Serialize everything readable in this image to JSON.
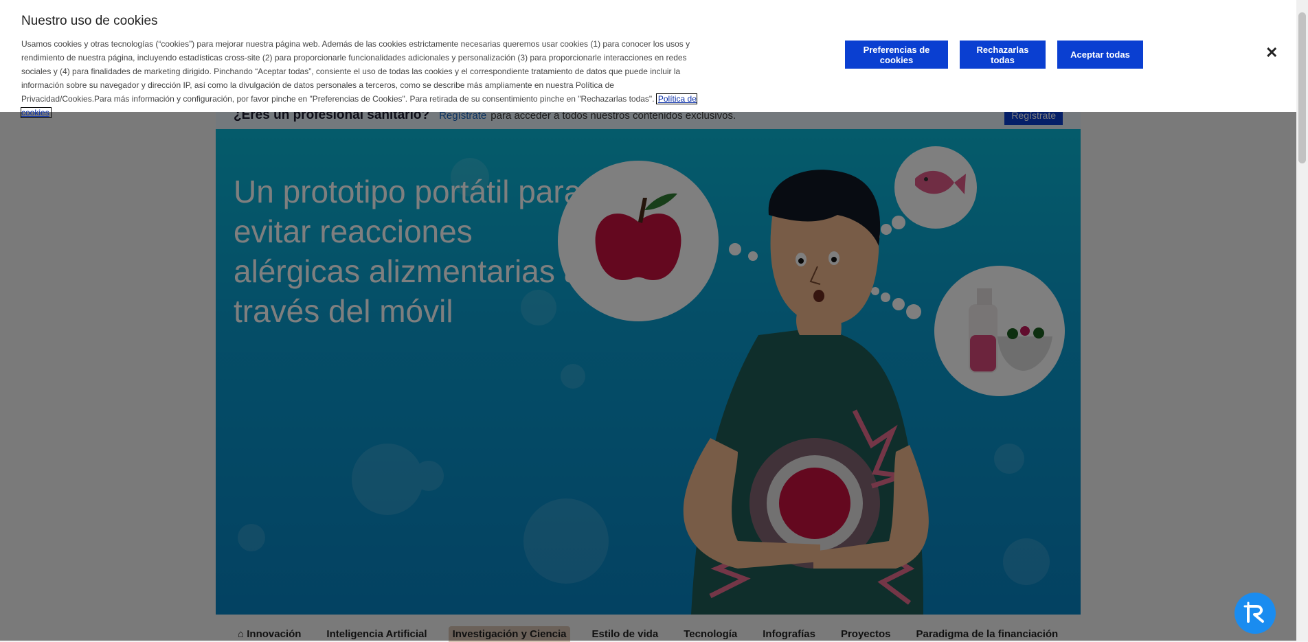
{
  "cookie_banner": {
    "title": "Nuestro uso de cookies",
    "body": "Usamos cookies y otras tecnologías (“cookies”) para mejorar nuestra página web. Además de las cookies estrictamente necesarias queremos usar cookies (1) para conocer los usos y rendimiento de nuestra página, incluyendo estadísticas cross-site (2) para proporcionarle funcionalidades adicionales y personalización (3) para proporcionarle interacciones en redes sociales y (4) para finalidades de marketing dirigido. Pinchando “Aceptar todas”, consiente el uso de todas las cookies y el correspondiente tratamiento de datos que puede incluir la información sobre su navegador y dirección IP, así como la divulgación de datos personales a terceros, como se describe más ampliamente en nuestra Política de Privacidad/Cookies.Para más información y configuración, por favor pinche en \"Preferencias de Cookies\". Para retirada de su consentimiento pinche en \"Rechazarlas todas\".",
    "policy_link": "Política de cookies",
    "preferences_label": "Preferencias de cookies",
    "reject_label": "Rechazarlas todas",
    "accept_label": "Aceptar todas",
    "close_glyph": "✕"
  },
  "pro_bar": {
    "title": "¿Eres un profesional sanitario?",
    "link": "Regístrate",
    "text": "para acceder a todos nuestros contenidos exclusivos.",
    "button": "Regístrate"
  },
  "hero": {
    "title": "Un prototipo portátil para evitar reacciones alérgicas alizmentarias a través del móvil"
  },
  "nav": {
    "items": [
      {
        "label": "Innovación",
        "icon": "home-icon"
      },
      {
        "label": "Inteligencia Artificial"
      },
      {
        "label": "Investigación y Ciencia",
        "active": true
      },
      {
        "label": "Estilo de vida"
      },
      {
        "label": "Tecnología"
      },
      {
        "label": "Infografías"
      },
      {
        "label": "Proyectos"
      },
      {
        "label": "Paradigma de la financiación"
      }
    ]
  },
  "colors": {
    "primary_button": "#0a3fd1",
    "hero_top": "#0bb7d6",
    "hero_bottom": "#0784c4",
    "fab": "#1a8cf0"
  },
  "fab": {
    "icon": "accessibility-icon"
  }
}
